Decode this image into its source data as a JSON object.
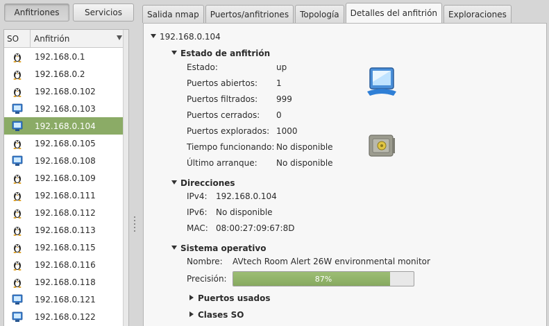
{
  "toolbar": {
    "hosts_button": "Anfitriones",
    "services_button": "Servicios"
  },
  "host_list": {
    "col_os": "SO",
    "col_host": "Anfitrión",
    "rows": [
      {
        "ip": "192.168.0.1",
        "os_icon": "linux-penguin-icon"
      },
      {
        "ip": "192.168.0.2",
        "os_icon": "linux-penguin-icon"
      },
      {
        "ip": "192.168.0.102",
        "os_icon": "linux-penguin-icon"
      },
      {
        "ip": "192.168.0.103",
        "os_icon": "monitor-icon"
      },
      {
        "ip": "192.168.0.104",
        "os_icon": "monitor-icon"
      },
      {
        "ip": "192.168.0.105",
        "os_icon": "linux-penguin-icon"
      },
      {
        "ip": "192.168.0.108",
        "os_icon": "monitor-icon"
      },
      {
        "ip": "192.168.0.109",
        "os_icon": "linux-penguin-icon"
      },
      {
        "ip": "192.168.0.111",
        "os_icon": "linux-penguin-icon"
      },
      {
        "ip": "192.168.0.112",
        "os_icon": "linux-penguin-icon"
      },
      {
        "ip": "192.168.0.113",
        "os_icon": "linux-penguin-icon"
      },
      {
        "ip": "192.168.0.115",
        "os_icon": "linux-penguin-icon"
      },
      {
        "ip": "192.168.0.116",
        "os_icon": "linux-penguin-icon"
      },
      {
        "ip": "192.168.0.118",
        "os_icon": "linux-penguin-icon"
      },
      {
        "ip": "192.168.0.121",
        "os_icon": "monitor-icon"
      },
      {
        "ip": "192.168.0.122",
        "os_icon": "monitor-icon"
      }
    ],
    "selected_ip": "192.168.0.104"
  },
  "tabs": [
    {
      "label": "Salida nmap"
    },
    {
      "label": "Puertos/anfitriones"
    },
    {
      "label": "Topología"
    },
    {
      "label": "Detalles del anfitrión",
      "active": true
    },
    {
      "label": "Exploraciones"
    }
  ],
  "details": {
    "host": "192.168.0.104",
    "status_section": {
      "title": "Estado de anfitrión",
      "rows": [
        {
          "label": "Estado:",
          "value": "up"
        },
        {
          "label": "Puertos abiertos:",
          "value": "1"
        },
        {
          "label": "Puertos filtrados:",
          "value": "999"
        },
        {
          "label": "Puertos cerrados:",
          "value": "0"
        },
        {
          "label": "Puertos explorados:",
          "value": "1000"
        },
        {
          "label": "Tiempo funcionando:",
          "value": "No disponible"
        },
        {
          "label": "Último arranque:",
          "value": "No disponible"
        }
      ]
    },
    "addresses_section": {
      "title": "Direcciones",
      "rows": [
        {
          "label": "IPv4:",
          "value": "192.168.0.104"
        },
        {
          "label": "IPv6:",
          "value": "No disponible"
        },
        {
          "label": "MAC:",
          "value": "08:00:27:09:67:8D"
        }
      ]
    },
    "os_section": {
      "title": "Sistema operativo",
      "name_label": "Nombre:",
      "name_value": "AVtech Room Alert 26W environmental monitor",
      "accuracy_label": "Precisión:",
      "accuracy_text": "87%",
      "accuracy_value": 0.87,
      "ports_used": "Puertos usados",
      "os_classes": "Clases SO"
    },
    "icons": {
      "os": "monitor-icon",
      "safety": "safe-icon"
    }
  },
  "colors": {
    "selection": "#8bab66",
    "progress": "#8fb169"
  }
}
